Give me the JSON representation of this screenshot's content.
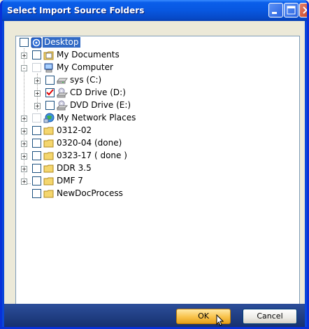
{
  "window": {
    "title": "Select Import Source Folders"
  },
  "tree": {
    "root": {
      "label": "Desktop",
      "icon": "desktop-icon",
      "checked": false,
      "selected": true
    },
    "items": [
      {
        "label": "My Documents",
        "icon": "my-documents-icon",
        "level": 1,
        "expander": "+",
        "checked": false
      },
      {
        "label": "My Computer",
        "icon": "my-computer-icon",
        "level": 1,
        "expander": "-",
        "checked": false
      },
      {
        "label": "sys (C:)",
        "icon": "hard-drive-icon",
        "level": 2,
        "expander": "+",
        "checked": false
      },
      {
        "label": "CD Drive (D:)",
        "icon": "cd-drive-icon",
        "level": 2,
        "expander": "+",
        "checked": true
      },
      {
        "label": "DVD Drive (E:)",
        "icon": "dvd-drive-icon",
        "level": 2,
        "expander": "+",
        "checked": false
      },
      {
        "label": "My Network Places",
        "icon": "network-places-icon",
        "level": 1,
        "expander": "+",
        "checked": false
      },
      {
        "label": "0312-02",
        "icon": "folder-icon",
        "level": 1,
        "expander": "+",
        "checked": false
      },
      {
        "label": "0320-04 (done)",
        "icon": "folder-icon",
        "level": 1,
        "expander": "+",
        "checked": false
      },
      {
        "label": "0323-17 ( done )",
        "icon": "folder-icon",
        "level": 1,
        "expander": "+",
        "checked": false
      },
      {
        "label": "DDR 3.5",
        "icon": "folder-icon",
        "level": 1,
        "expander": "+",
        "checked": false
      },
      {
        "label": "DMF 7",
        "icon": "folder-icon",
        "level": 1,
        "expander": "+",
        "checked": false
      },
      {
        "label": "NewDocProcess",
        "icon": "folder-icon",
        "level": 1,
        "expander": "",
        "checked": false
      }
    ]
  },
  "buttons": {
    "ok": "OK",
    "cancel": "Cancel"
  },
  "colors": {
    "titlebar": "#0857E0",
    "selection": "#316AC5",
    "check": "#E00000",
    "folder": "#F4D66E"
  }
}
